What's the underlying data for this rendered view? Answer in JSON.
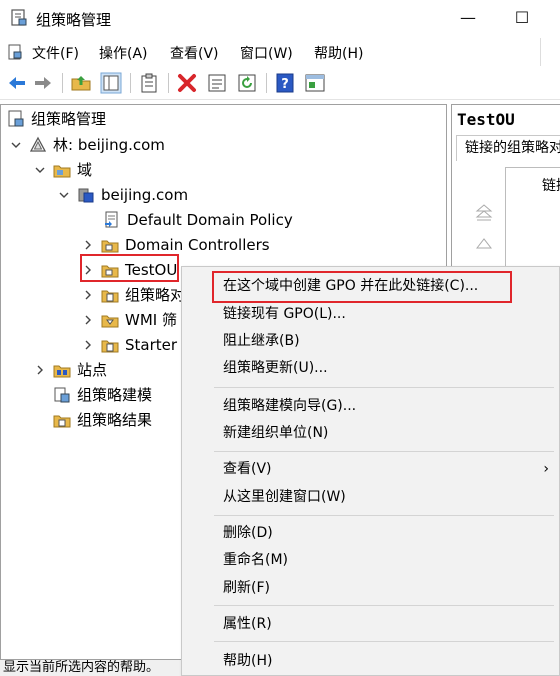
{
  "window": {
    "title": "组策略管理",
    "minimize": "—",
    "maximize": "☐"
  },
  "menubar": {
    "items": [
      "文件(F)",
      "操作(A)",
      "查看(V)",
      "窗口(W)",
      "帮助(H)"
    ]
  },
  "toolbar": {
    "icons": [
      "back-arrow-icon",
      "forward-arrow-icon",
      "up-folder-icon",
      "show-hide-tree-icon",
      "clipboard-icon",
      "delete-x-icon",
      "properties-icon",
      "refresh-icon",
      "help-icon",
      "console-icon"
    ]
  },
  "tree": {
    "root": "组策略管理",
    "forest": "林: beijing.com",
    "domains": "域",
    "domain": "beijing.com",
    "default_policy": "Default Domain Policy",
    "domain_controllers": "Domain Controllers",
    "testou": "TestOU",
    "gpo_obj": "组策略对",
    "wmi": "WMI 筛",
    "starter": "Starter",
    "sites": "站点",
    "modeling": "组策略建模",
    "results": "组策略结果"
  },
  "right_pane": {
    "title": "TestOU",
    "tab": "链接的组策略对",
    "col": "链接"
  },
  "status": "显示当前所选内容的帮助。",
  "context_menu": {
    "items": [
      "在这个域中创建 GPO 并在此处链接(C)...",
      "链接现有 GPO(L)...",
      "阻止继承(B)",
      "组策略更新(U)...",
      "组策略建模向导(G)...",
      "新建组织单位(N)",
      "查看(V)",
      "从这里创建窗口(W)",
      "删除(D)",
      "重命名(M)",
      "刷新(F)",
      "属性(R)",
      "帮助(H)"
    ],
    "submenu_arrow": "›"
  },
  "colors": {
    "highlight": "#e0262b",
    "folder": "#e8b84a",
    "toolbar_blue": "#2b79d8"
  }
}
